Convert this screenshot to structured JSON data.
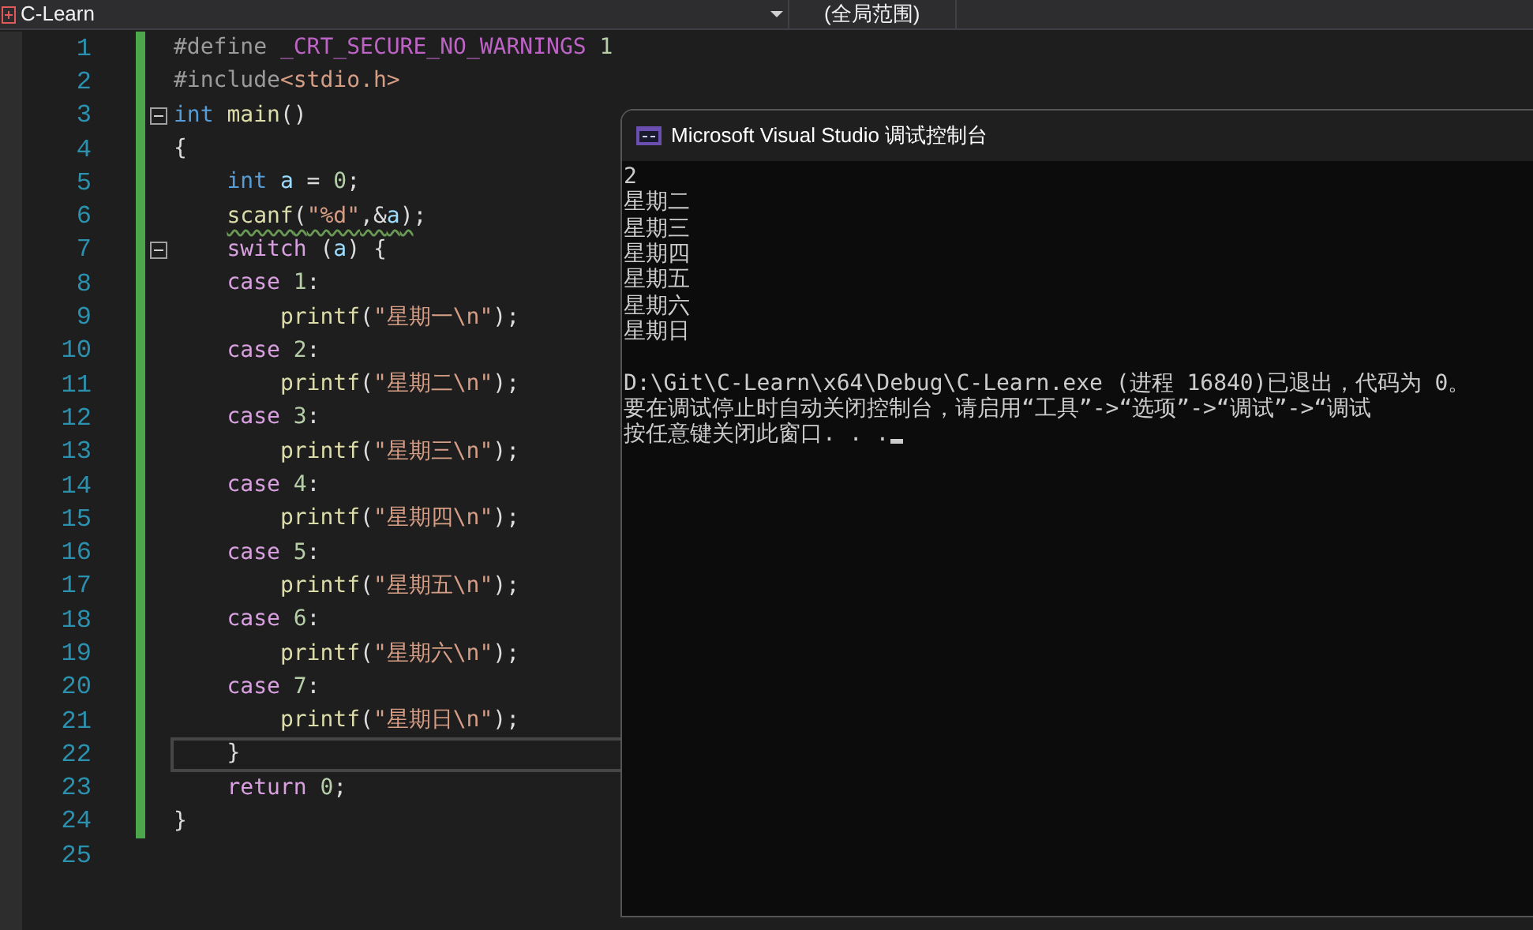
{
  "toolbar": {
    "project": "C-Learn",
    "scope": "(全局范围)"
  },
  "editor": {
    "lines": [
      {
        "number": "1",
        "modified": true,
        "current": false,
        "foldable": false,
        "tokens": [
          {
            "text": "#define ",
            "kind": "preproc"
          },
          {
            "text": "_CRT_SECURE_NO_WARNINGS",
            "kind": "macro"
          },
          {
            "text": " 1",
            "kind": "number"
          }
        ]
      },
      {
        "number": "2",
        "modified": true,
        "current": false,
        "foldable": false,
        "tokens": [
          {
            "text": "#include",
            "kind": "preproc"
          },
          {
            "text": "<stdio.h>",
            "kind": "string"
          }
        ]
      },
      {
        "number": "3",
        "modified": true,
        "current": false,
        "foldable": true,
        "tokens": [
          {
            "text": "int",
            "kind": "keyword"
          },
          {
            "text": " main",
            "kind": "func"
          },
          {
            "text": "()",
            "kind": "plain"
          }
        ]
      },
      {
        "number": "4",
        "modified": true,
        "current": false,
        "foldable": false,
        "tokens": [
          {
            "text": "{",
            "kind": "plain"
          }
        ],
        "children": [
          {
            "number": "5",
            "modified": true,
            "current": false,
            "foldable": false,
            "tokens": [
              {
                "text": "int",
                "kind": "keyword"
              },
              {
                "text": " a",
                "kind": "var"
              },
              {
                "text": " = ",
                "kind": "plain"
              },
              {
                "text": "0",
                "kind": "number"
              },
              {
                "text": ";",
                "kind": "plain"
              }
            ]
          },
          {
            "number": "6",
            "modified": true,
            "current": false,
            "foldable": false,
            "tokens": [
              {
                "text": "scanf",
                "kind": "func",
                "squiggle": true
              },
              {
                "text": "(",
                "kind": "plain",
                "squiggle": true
              },
              {
                "text": "\"%d\"",
                "kind": "string",
                "squiggle": true
              },
              {
                "text": ",&",
                "kind": "plain",
                "squiggle": true
              },
              {
                "text": "a",
                "kind": "var",
                "squiggle": true
              },
              {
                "text": ")",
                "kind": "plain",
                "squiggle": true
              },
              {
                "text": ";",
                "kind": "plain"
              }
            ]
          },
          {
            "number": "7",
            "modified": true,
            "current": false,
            "foldable": true,
            "tokens": [
              {
                "text": "switch",
                "kind": "control"
              },
              {
                "text": " (",
                "kind": "plain"
              },
              {
                "text": "a",
                "kind": "var"
              },
              {
                "text": ") {",
                "kind": "plain"
              }
            ]
          },
          {
            "number": "8",
            "modified": true,
            "current": false,
            "foldable": false,
            "tokens": [
              {
                "text": "case",
                "kind": "control"
              },
              {
                "text": " 1",
                "kind": "number"
              },
              {
                "text": ":",
                "kind": "plain"
              }
            ],
            "children": [
              {
                "number": "9",
                "modified": true,
                "current": false,
                "foldable": false,
                "tokens": [
                  {
                    "text": "printf",
                    "kind": "func"
                  },
                  {
                    "text": "(",
                    "kind": "plain"
                  },
                  {
                    "text": "\"星期一\\n\"",
                    "kind": "string"
                  },
                  {
                    "text": ");",
                    "kind": "plain"
                  }
                ]
              }
            ]
          },
          {
            "number": "10",
            "modified": true,
            "current": false,
            "foldable": false,
            "tokens": [
              {
                "text": "case",
                "kind": "control"
              },
              {
                "text": " 2",
                "kind": "number"
              },
              {
                "text": ":",
                "kind": "plain"
              }
            ],
            "children": [
              {
                "number": "11",
                "modified": true,
                "current": false,
                "foldable": false,
                "tokens": [
                  {
                    "text": "printf",
                    "kind": "func"
                  },
                  {
                    "text": "(",
                    "kind": "plain"
                  },
                  {
                    "text": "\"星期二\\n\"",
                    "kind": "string"
                  },
                  {
                    "text": ");",
                    "kind": "plain"
                  }
                ]
              }
            ]
          },
          {
            "number": "12",
            "modified": true,
            "current": false,
            "foldable": false,
            "tokens": [
              {
                "text": "case",
                "kind": "control"
              },
              {
                "text": " 3",
                "kind": "number"
              },
              {
                "text": ":",
                "kind": "plain"
              }
            ],
            "children": [
              {
                "number": "13",
                "modified": true,
                "current": false,
                "foldable": false,
                "tokens": [
                  {
                    "text": "printf",
                    "kind": "func"
                  },
                  {
                    "text": "(",
                    "kind": "plain"
                  },
                  {
                    "text": "\"星期三\\n\"",
                    "kind": "string"
                  },
                  {
                    "text": ");",
                    "kind": "plain"
                  }
                ]
              }
            ]
          },
          {
            "number": "14",
            "modified": true,
            "current": false,
            "foldable": false,
            "tokens": [
              {
                "text": "case",
                "kind": "control"
              },
              {
                "text": " 4",
                "kind": "number"
              },
              {
                "text": ":",
                "kind": "plain"
              }
            ],
            "children": [
              {
                "number": "15",
                "modified": true,
                "current": false,
                "foldable": false,
                "tokens": [
                  {
                    "text": "printf",
                    "kind": "func"
                  },
                  {
                    "text": "(",
                    "kind": "plain"
                  },
                  {
                    "text": "\"星期四\\n\"",
                    "kind": "string"
                  },
                  {
                    "text": ");",
                    "kind": "plain"
                  }
                ]
              }
            ]
          },
          {
            "number": "16",
            "modified": true,
            "current": false,
            "foldable": false,
            "tokens": [
              {
                "text": "case",
                "kind": "control"
              },
              {
                "text": " 5",
                "kind": "number"
              },
              {
                "text": ":",
                "kind": "plain"
              }
            ],
            "children": [
              {
                "number": "17",
                "modified": true,
                "current": false,
                "foldable": false,
                "tokens": [
                  {
                    "text": "printf",
                    "kind": "func"
                  },
                  {
                    "text": "(",
                    "kind": "plain"
                  },
                  {
                    "text": "\"星期五\\n\"",
                    "kind": "string"
                  },
                  {
                    "text": ");",
                    "kind": "plain"
                  }
                ]
              }
            ]
          },
          {
            "number": "18",
            "modified": true,
            "current": false,
            "foldable": false,
            "tokens": [
              {
                "text": "case",
                "kind": "control"
              },
              {
                "text": " 6",
                "kind": "number"
              },
              {
                "text": ":",
                "kind": "plain"
              }
            ],
            "children": [
              {
                "number": "19",
                "modified": true,
                "current": false,
                "foldable": false,
                "tokens": [
                  {
                    "text": "printf",
                    "kind": "func"
                  },
                  {
                    "text": "(",
                    "kind": "plain"
                  },
                  {
                    "text": "\"星期六\\n\"",
                    "kind": "string"
                  },
                  {
                    "text": ");",
                    "kind": "plain"
                  }
                ]
              }
            ]
          },
          {
            "number": "20",
            "modified": true,
            "current": false,
            "foldable": false,
            "tokens": [
              {
                "text": "case",
                "kind": "control"
              },
              {
                "text": " 7",
                "kind": "number"
              },
              {
                "text": ":",
                "kind": "plain"
              }
            ],
            "children": [
              {
                "number": "21",
                "modified": true,
                "current": false,
                "foldable": false,
                "tokens": [
                  {
                    "text": "printf",
                    "kind": "func"
                  },
                  {
                    "text": "(",
                    "kind": "plain"
                  },
                  {
                    "text": "\"星期日\\n\"",
                    "kind": "string"
                  },
                  {
                    "text": ");",
                    "kind": "plain"
                  }
                ]
              }
            ]
          },
          {
            "number": "22",
            "modified": true,
            "current": true,
            "foldable": false,
            "tokens": [
              {
                "text": "}",
                "kind": "plain"
              }
            ]
          },
          {
            "number": "23",
            "modified": true,
            "current": false,
            "foldable": false,
            "tokens": [
              {
                "text": "return",
                "kind": "control"
              },
              {
                "text": " 0",
                "kind": "number"
              },
              {
                "text": ";",
                "kind": "plain"
              }
            ]
          }
        ]
      },
      {
        "number": "24",
        "modified": true,
        "current": false,
        "foldable": false,
        "tokens": [
          {
            "text": "}",
            "kind": "plain"
          }
        ]
      },
      {
        "number": "25",
        "modified": false,
        "current": false,
        "foldable": false
      }
    ]
  },
  "console": {
    "title": "Microsoft Visual Studio 调试控制台",
    "output": [
      "2",
      "星期二",
      "星期三",
      "星期四",
      "星期五",
      "星期六",
      "星期日"
    ],
    "messages": [
      "D:\\Git\\C-Learn\\x64\\Debug\\C-Learn.exe (进程 16840)已退出，代码为 0。",
      "要在调试停止时自动关闭控制台，请启用“工具”->“选项”->“调试”->“调试",
      "按任意键关闭此窗口. . ."
    ]
  }
}
